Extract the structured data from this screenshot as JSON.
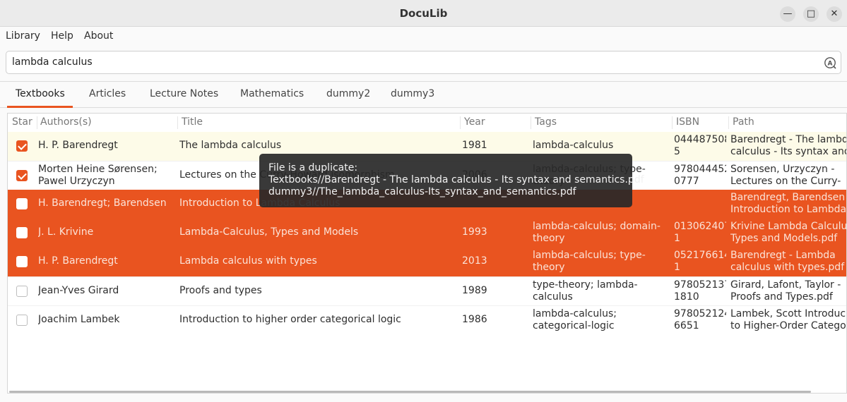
{
  "window": {
    "title": "DocuLib"
  },
  "menu": [
    "Library",
    "Help",
    "About"
  ],
  "search": {
    "value": "lambda calculus",
    "icon": "search-icon"
  },
  "tabs": [
    "Textbooks",
    "Articles",
    "Lecture Notes",
    "Mathematics",
    "dummy2",
    "dummy3"
  ],
  "active_tab": "Textbooks",
  "columns": [
    "Star",
    "Authors(s)",
    "Title",
    "Year",
    "Tags",
    "ISBN",
    "Path"
  ],
  "rows": [
    {
      "starred": true,
      "authors": [
        "H. P. Barendregt"
      ],
      "title": "The lambda calculus",
      "year": "1981",
      "tags": [
        "lambda-calculus"
      ],
      "isbn": [
        "044487508",
        "5"
      ],
      "path": [
        "Barendregt - The lambd",
        "calculus - Its syntax and"
      ],
      "state": "highlight"
    },
    {
      "starred": true,
      "authors": [
        "Morten Heine Sørensen;",
        "Pawel Urzyczyn"
      ],
      "title": "Lectures on the Curry-Howard isomorphism",
      "year": "2006",
      "tags": [
        "lambda-calculus; type-",
        "theory"
      ],
      "isbn": [
        "978044452",
        "0777"
      ],
      "path": [
        "Sorensen, Urzyczyn -",
        "Lectures on the Curry-"
      ],
      "state": "normal"
    },
    {
      "starred": false,
      "authors": [
        "H. Barendregt; Barendsen"
      ],
      "title": "Introduction to Lambda Calculus",
      "year": "",
      "tags": [],
      "isbn": [],
      "path": [
        "Barendregt, Barendsen",
        "Introduction to Lambda"
      ],
      "state": "selected"
    },
    {
      "starred": false,
      "authors": [
        "J. L. Krivine"
      ],
      "title": "Lambda-Calculus, Types and Models",
      "year": "1993",
      "tags": [
        "lambda-calculus; domain-",
        "theory"
      ],
      "isbn": [
        "013062407",
        "1"
      ],
      "path": [
        "Krivine Lambda Calculu",
        "Types and Models.pdf"
      ],
      "state": "selected"
    },
    {
      "starred": false,
      "authors": [
        "H. P. Barendregt"
      ],
      "title": "Lambda calculus with types",
      "year": "2013",
      "tags": [
        "lambda-calculus; type-",
        "theory"
      ],
      "isbn": [
        "052176614",
        "1"
      ],
      "path": [
        "Barendregt - Lambda",
        "calculus with types.pdf"
      ],
      "state": "selected"
    },
    {
      "starred": false,
      "authors": [
        "Jean-Yves Girard"
      ],
      "title": "Proofs and types",
      "year": "1989",
      "tags": [
        "type-theory; lambda-",
        "calculus"
      ],
      "isbn": [
        "978052137",
        "1810"
      ],
      "path": [
        "Girard, Lafont, Taylor -",
        "Proofs and Types.pdf"
      ],
      "state": "normal"
    },
    {
      "starred": false,
      "authors": [
        "Joachim Lambek"
      ],
      "title": "Introduction to higher order categorical logic",
      "year": "1986",
      "tags": [
        "lambda-calculus;",
        "categorical-logic"
      ],
      "isbn": [
        "978052124",
        "6651"
      ],
      "path": [
        "Lambek, Scott Introduc",
        "to Higher-Order Catego"
      ],
      "state": "normal"
    }
  ],
  "tooltip": {
    "lines": [
      "File is a duplicate:",
      "Textbooks//Barendregt - The lambda calculus - Its syntax and semantics.pdf",
      "dummy3//The_lambda_calculus-Its_syntax_and_semantics.pdf"
    ]
  },
  "colors": {
    "accent": "#e95420",
    "highlight_row": "#fdfbe8",
    "tooltip_bg": "#282828"
  }
}
